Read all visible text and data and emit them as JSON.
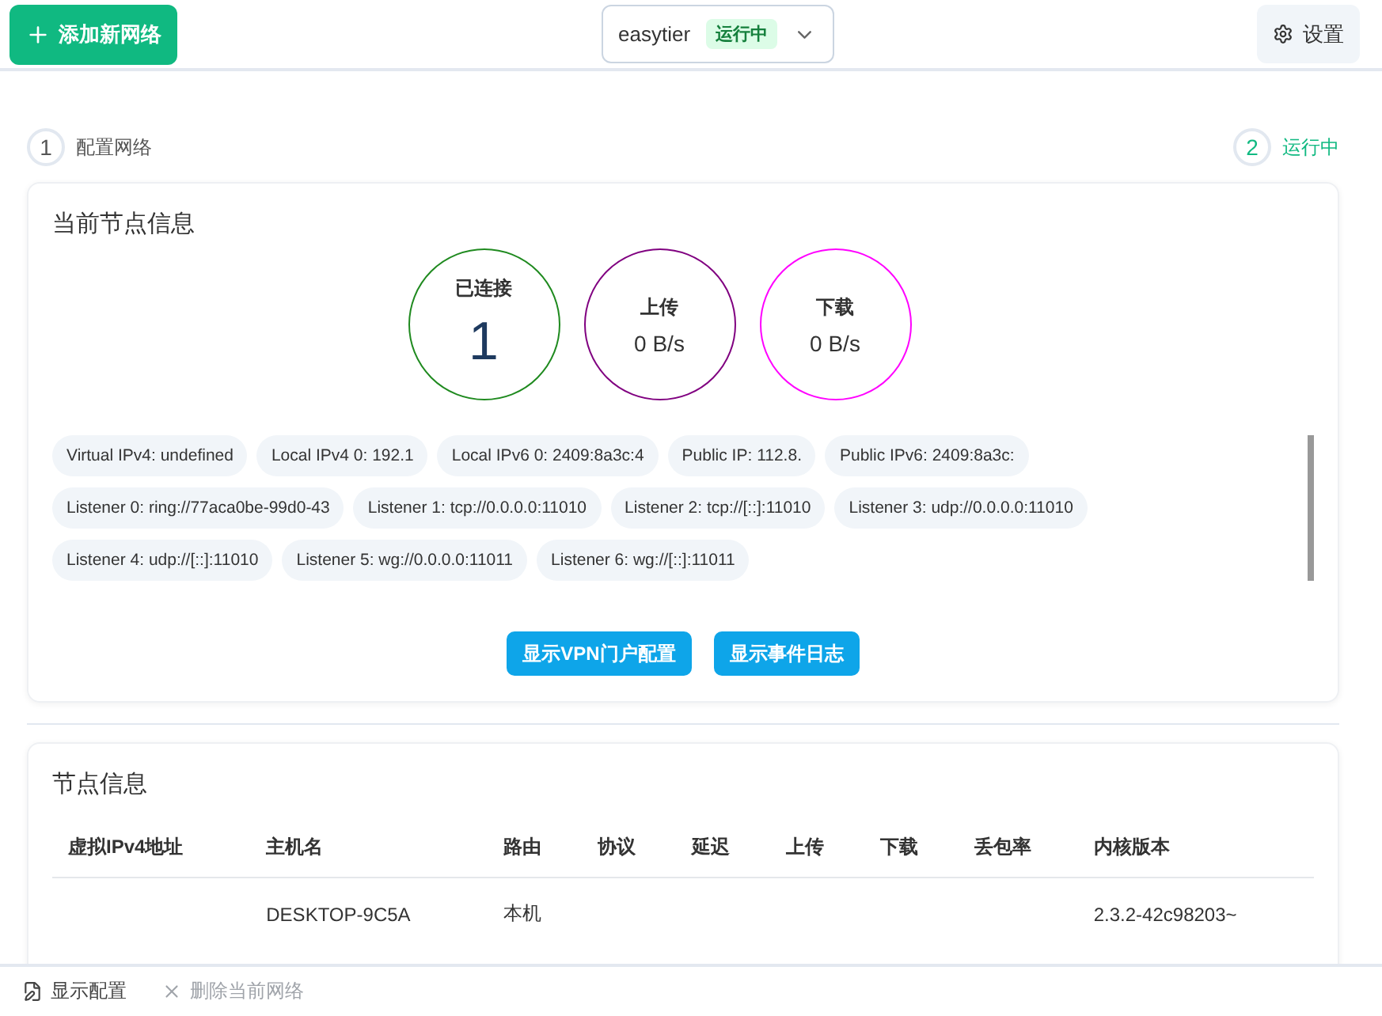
{
  "toolbar": {
    "add_button": "添加新网络",
    "network_select": {
      "value": "easytier",
      "status": "运行中"
    },
    "settings_button": "设置"
  },
  "steps": [
    {
      "number": "1",
      "label": "配置网络",
      "selected": false
    },
    {
      "number": "2",
      "label": "运行中",
      "selected": true
    }
  ],
  "node_card": {
    "title": "当前节点信息",
    "stats": [
      {
        "label": "已连接",
        "value": "1",
        "color": "#1f8a1f",
        "big": true
      },
      {
        "label": "上传",
        "value": "0 B/s",
        "color": "#800080",
        "big": false
      },
      {
        "label": "下载",
        "value": "0 B/s",
        "color": "#ff00ff",
        "big": false
      }
    ],
    "chips": [
      "Virtual IPv4: undefined",
      "Local IPv4 0: 192.1",
      "Local IPv6 0: 2409:8a3c:4",
      "Public IP: 112.8.",
      "Public IPv6: 2409:8a3c:",
      "Listener 0: ring://77aca0be-99d0-43",
      "Listener 1: tcp://0.0.0.0:11010",
      "Listener 2: tcp://[::]:11010",
      "Listener 3: udp://0.0.0.0:11010",
      "Listener 4: udp://[::]:11010",
      "Listener 5: wg://0.0.0.0:11011",
      "Listener 6: wg://[::]:11011"
    ],
    "buttons": [
      "显示VPN门户配置",
      "显示事件日志"
    ]
  },
  "peers_card": {
    "title": "节点信息",
    "columns": [
      "虚拟IPv4地址",
      "主机名",
      "路由",
      "协议",
      "延迟",
      "上传",
      "下载",
      "丢包率",
      "内核版本"
    ],
    "rows": [
      [
        "",
        "DESKTOP-9C5A",
        "本机",
        "",
        "",
        "",
        "",
        "",
        "2.3.2-42c98203~"
      ]
    ]
  },
  "footer": {
    "show_config": "显示配置",
    "delete_network": {
      "label": "删除当前网络",
      "disabled": true
    }
  }
}
